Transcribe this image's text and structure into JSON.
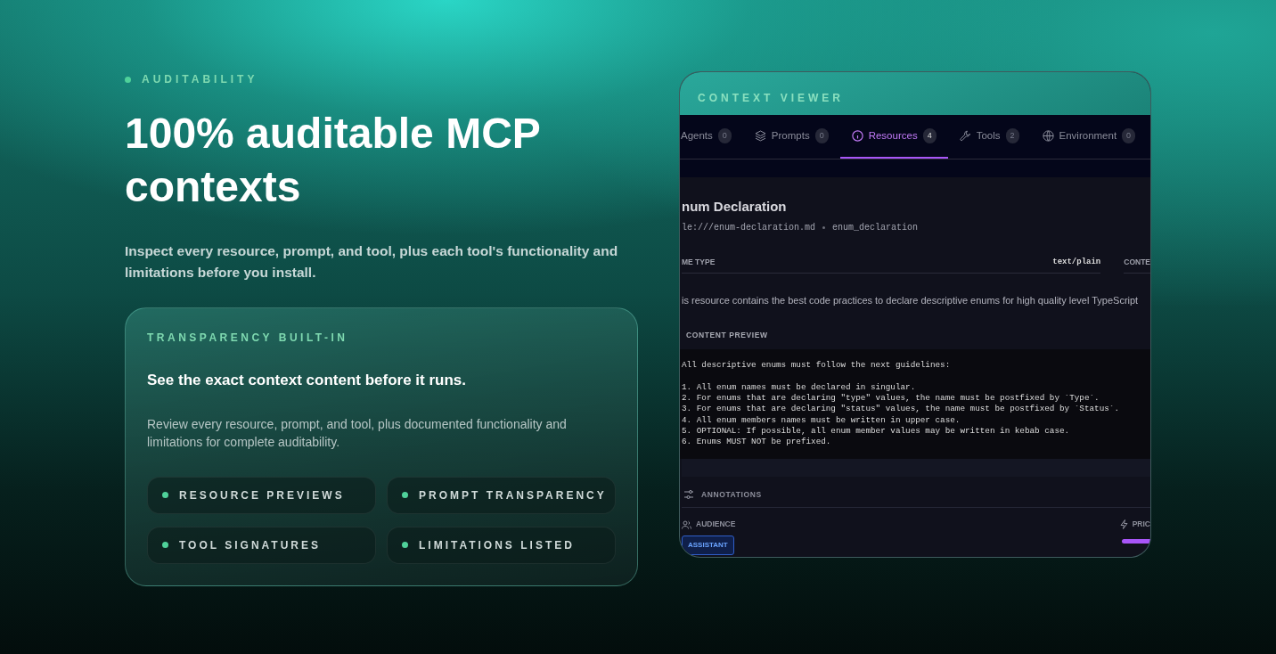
{
  "eyebrow": "AUDITABILITY",
  "headline": "100% auditable MCP contexts",
  "subtitle": "Inspect every resource, prompt, and tool, plus each tool's functionality and limitations before you install.",
  "feature_card": {
    "label": "TRANSPARENCY BUILT-IN",
    "title": "See the exact context content before it runs.",
    "body": "Review every resource, prompt, and tool, plus documented functionality and limitations for complete auditability.",
    "chips": [
      "RESOURCE PREVIEWS",
      "PROMPT TRANSPARENCY",
      "TOOL SIGNATURES",
      "LIMITATIONS LISTED"
    ]
  },
  "viewer": {
    "title": "CONTEXT VIEWER",
    "tabs": [
      {
        "kind": "agents",
        "label": "Agents",
        "count": "0",
        "selected": false
      },
      {
        "kind": "prompts",
        "label": "Prompts",
        "count": "0",
        "selected": false
      },
      {
        "kind": "resources",
        "label": "Resources",
        "count": "4",
        "selected": true
      },
      {
        "kind": "tools",
        "label": "Tools",
        "count": "2",
        "selected": false
      },
      {
        "kind": "environment",
        "label": "Environment",
        "count": "0",
        "selected": false
      }
    ],
    "resource_title": "num Declaration",
    "resource_uri": "le:///enum-declaration.md",
    "resource_name": "enum_declaration",
    "mime_label": "ME TYPE",
    "mime_value": "text/plain",
    "column_3": "CONTE",
    "description": "is resource contains the best code practices to declare descriptive enums for high quality level TypeScript",
    "preview_label": "CONTENT PREVIEW",
    "preview_intro": "All descriptive enums must follow the next guidelines:",
    "preview_lines": [
      "1. All enum names must be declared in singular.",
      "2. For enums that are declaring \"type\" values, the name must be postfixed by `Type`.",
      "3. For enums that are declaring \"status\" values, the name must be postfixed by `Status`.",
      "4. All enum members names must be written in upper case.",
      "5. OPTIONAL: If possible, all enum member values may be written in kebab case.",
      "6. Enums MUST NOT be prefixed."
    ],
    "annotations_label": "ANNOTATIONS",
    "audience_label": "AUDIENCE",
    "audience_badge": "ASSISTANT",
    "priority_label": "PRIC"
  }
}
